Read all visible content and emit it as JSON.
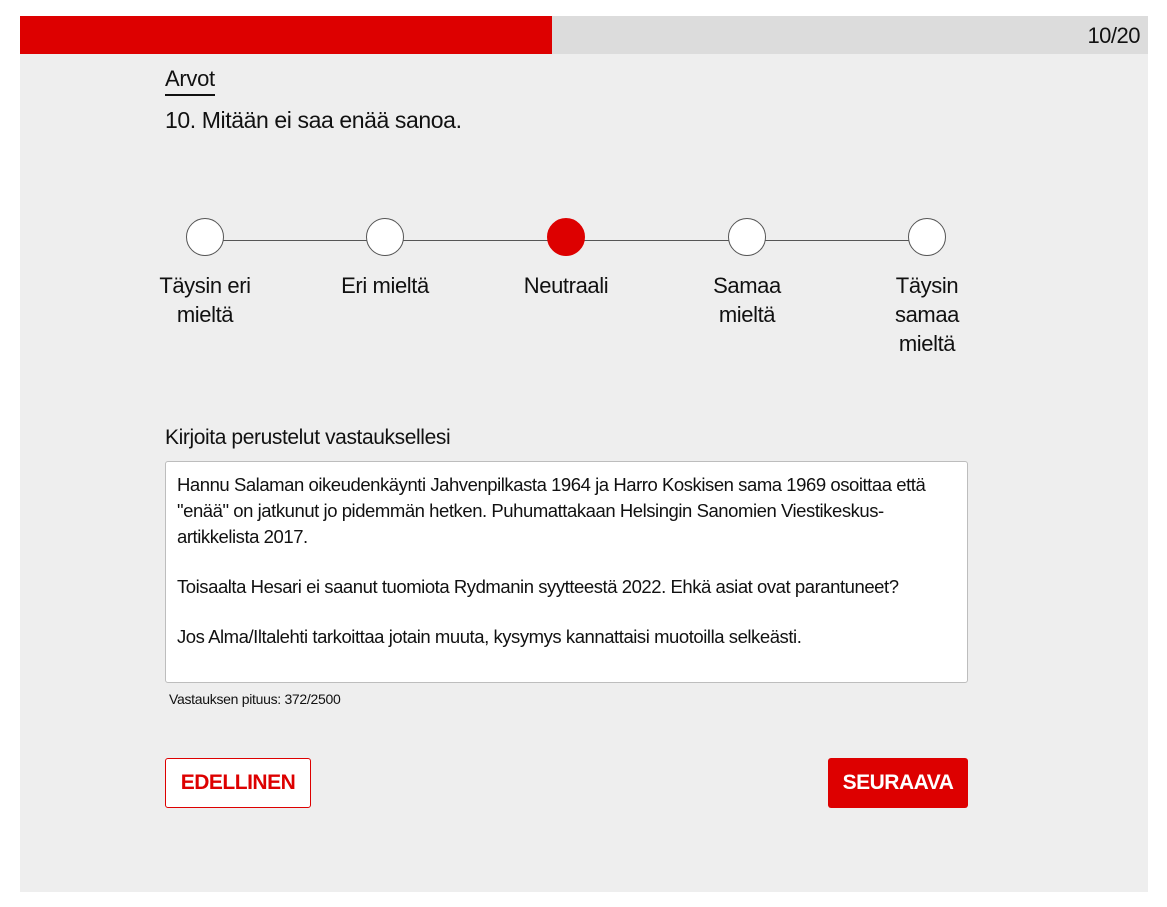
{
  "progress": {
    "current": 10,
    "total": 20,
    "fraction": 0.472,
    "label": "10/20",
    "color": "#dd0000"
  },
  "question": {
    "category": "Arvot",
    "title": "10. Mitään ei saa enää sanoa."
  },
  "scale": {
    "selected_index": 2,
    "options": [
      {
        "label": "Täysin eri mieltä"
      },
      {
        "label": "Eri mieltä"
      },
      {
        "label": "Neutraali"
      },
      {
        "label": "Samaa mieltä"
      },
      {
        "label": "Täysin samaa mieltä"
      }
    ]
  },
  "answer": {
    "label": "Kirjoita perustelut vastauksellesi",
    "paragraphs": [
      "Hannu Salaman oikeudenkäynti Jahvenpilkasta 1964 ja Harro Koskisen sama 1969 osoittaa että \"enää\" on jatkunut jo pidemmän hetken. Puhumattakaan Helsingin Sanomien Viestikeskus-artikkelista 2017.",
      "Toisaalta Hesari ei saanut tuomiota Rydmanin syytteestä 2022. Ehkä asiat ovat parantuneet?",
      "Jos Alma/Iltalehti tarkoittaa jotain muuta, kysymys kannattaisi muotoilla selkeästi."
    ],
    "length_label": "Vastauksen pituus: 372/2500"
  },
  "nav": {
    "prev_label": "EDELLINEN",
    "next_label": "SEURAAVA"
  }
}
